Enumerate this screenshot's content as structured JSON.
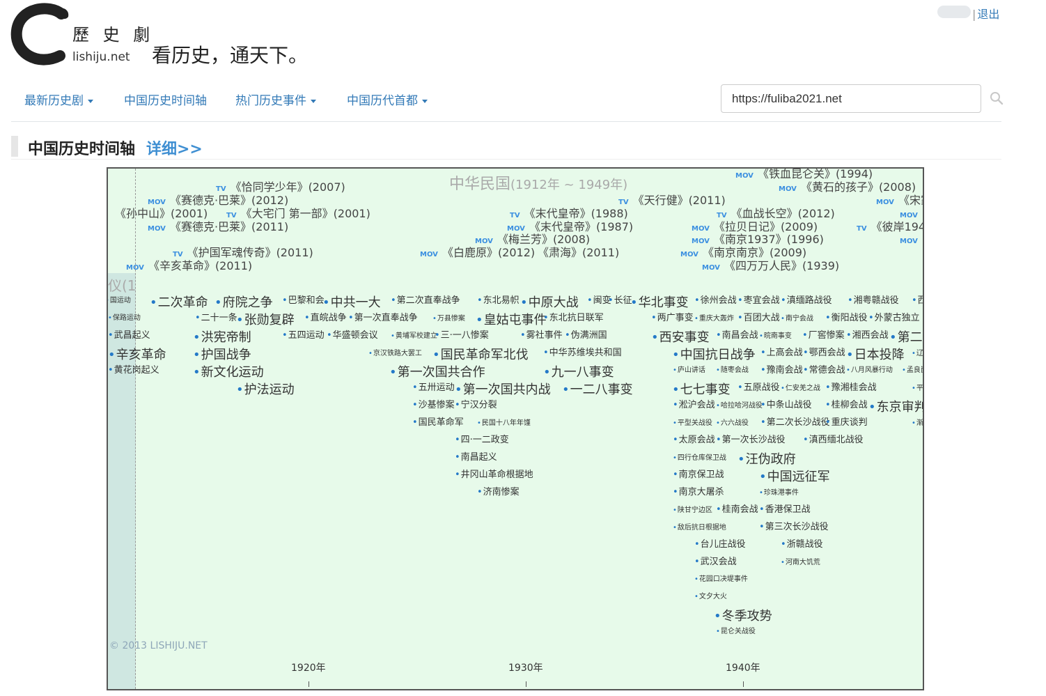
{
  "header": {
    "logo_chars": "歷 史 劇",
    "logo_domain": "lishiju.net",
    "slogan": "看历史，通天下。",
    "logout": "退出"
  },
  "nav": {
    "items": [
      {
        "label": "最新历史剧",
        "dropdown": true
      },
      {
        "label": "中国历史时间轴",
        "dropdown": false
      },
      {
        "label": "热门历史事件",
        "dropdown": true
      },
      {
        "label": "中国历代首都",
        "dropdown": true
      }
    ],
    "search_value": "https://fuliba2021.net"
  },
  "section": {
    "title": "中国历史时间轴",
    "more": "详细>>"
  },
  "timeline": {
    "era": "中华民国",
    "era_range": "(1912年 ~ 1949年)",
    "left_era_fragment": "仪(1",
    "copyright": "© 2013 LISHIJU.NET",
    "ticks": [
      "1920年",
      "1930年",
      "1940年"
    ],
    "films": [
      {
        "type": "TV",
        "title": "《恰同学少年》(2007)"
      },
      {
        "type": "MOV",
        "title": "《赛德克·巴莱》(2012)"
      },
      {
        "type": "",
        "title": "《孙中山》(2001)"
      },
      {
        "type": "TV",
        "title": "《大宅门 第一部》(2001)"
      },
      {
        "type": "MOV",
        "title": "《赛德克·巴莱》(2011)"
      },
      {
        "type": "TV",
        "title": "《护国军魂传奇》(2011)"
      },
      {
        "type": "MOV",
        "title": "《辛亥革命》(2011)"
      },
      {
        "type": "TV",
        "title": "《天行健》(2011)"
      },
      {
        "type": "TV",
        "title": "《末代皇帝》(1988)"
      },
      {
        "type": "MOV",
        "title": "《末代皇帝》(1987)"
      },
      {
        "type": "MOV",
        "title": "《梅兰芳》(2008)"
      },
      {
        "type": "MOV",
        "title": "《白鹿原》(2012)"
      },
      {
        "type": "",
        "title": "《肃海》(2011)"
      },
      {
        "type": "MOV",
        "title": "《铁血昆仑关》(1994)"
      },
      {
        "type": "MOV",
        "title": "《黄石的孩子》(2008)"
      },
      {
        "type": "TV",
        "title": "《血战长空》(2012)"
      },
      {
        "type": "MOV",
        "title": "《拉贝日记》(2009)"
      },
      {
        "type": "MOV",
        "title": "《南京1937》(1996)"
      },
      {
        "type": "MOV",
        "title": "《南京南京》(2009)"
      },
      {
        "type": "MOV",
        "title": "《四万万人民》(1939)"
      },
      {
        "type": "MOV",
        "title": "《宋家"
      },
      {
        "type": "MOV",
        "title": ""
      },
      {
        "type": "TV",
        "title": "《彼岸194"
      },
      {
        "type": "MOV",
        "title": ""
      }
    ],
    "events": [
      "国运动",
      "二次革命",
      "府院之争",
      "巴黎和会",
      "中共一大",
      "第二次直奉战争",
      "东北易帜",
      "中原大战",
      "闽变",
      "长征",
      "华北事变",
      "徐州会战",
      "枣宜会战",
      "滇缅路战役",
      "湘粤赣战役",
      "西",
      "保路运动",
      "二十一条",
      "张勋复辟",
      "直皖战争",
      "第一次直奉战争",
      "万县惨案",
      "皇姑屯事件",
      "东北抗日联军",
      "两广事变",
      "重庆大轰炸",
      "百团大战",
      "南宁会战",
      "衡阳战役",
      "外蒙古独立",
      "武昌起义",
      "洪宪帝制",
      "五四运动",
      "华盛顿会议",
      "黄埔军校建立",
      "三·一八惨案",
      "雾社事件",
      "伪满洲国",
      "西安事变",
      "南昌会战",
      "晥南事变",
      "厂窖惨案",
      "湘西会战",
      "第二",
      "辛亥革命",
      "护国战争",
      "京汉铁路大罢工",
      "国民革命军北伐",
      "中华苏维埃共和国",
      "中国抗日战争",
      "上高会战",
      "鄂西会战",
      "日本投降",
      "辽",
      "黄花岗起义",
      "新文化运动",
      "第一次国共合作",
      "九一八事变",
      "庐山讲话",
      "随枣会战",
      "豫南会战",
      "常德会战",
      "八月风暴行动",
      "孟良崮",
      "护法运动",
      "五卅运动",
      "第一次国共内战",
      "一二八事变",
      "七七事变",
      "五原战役",
      "仁安羌之战",
      "豫湘桂会战",
      "平",
      "沙基惨案",
      "宁汉分裂",
      "淞沪会战",
      "哈拉哈河战役",
      "中条山战役",
      "桂柳会战",
      "东京审判",
      "国民革命军",
      "民国十八年年馑",
      "平型关战役",
      "六六战役",
      "第二次长沙战役",
      "重庆谈判",
      "渐",
      "四·一二政变",
      "太原会战",
      "第一次长沙战役",
      "滇西缅北战役",
      "南昌起义",
      "四行仓库保卫战",
      "汪伪政府",
      "井冈山革命根据地",
      "南京保卫战",
      "中国远征军",
      "济南惨案",
      "南京大屠杀",
      "珍珠港事件",
      "陕甘宁边区",
      "桂南会战",
      "香港保卫战",
      "敌后抗日根据地",
      "第三次长沙战役",
      "台儿庄战役",
      "浙赣战役",
      "武汉会战",
      "河南大饥荒",
      "花园口决堤事件",
      "文夕大火",
      "冬季攻势",
      "昆仑关战役"
    ]
  }
}
